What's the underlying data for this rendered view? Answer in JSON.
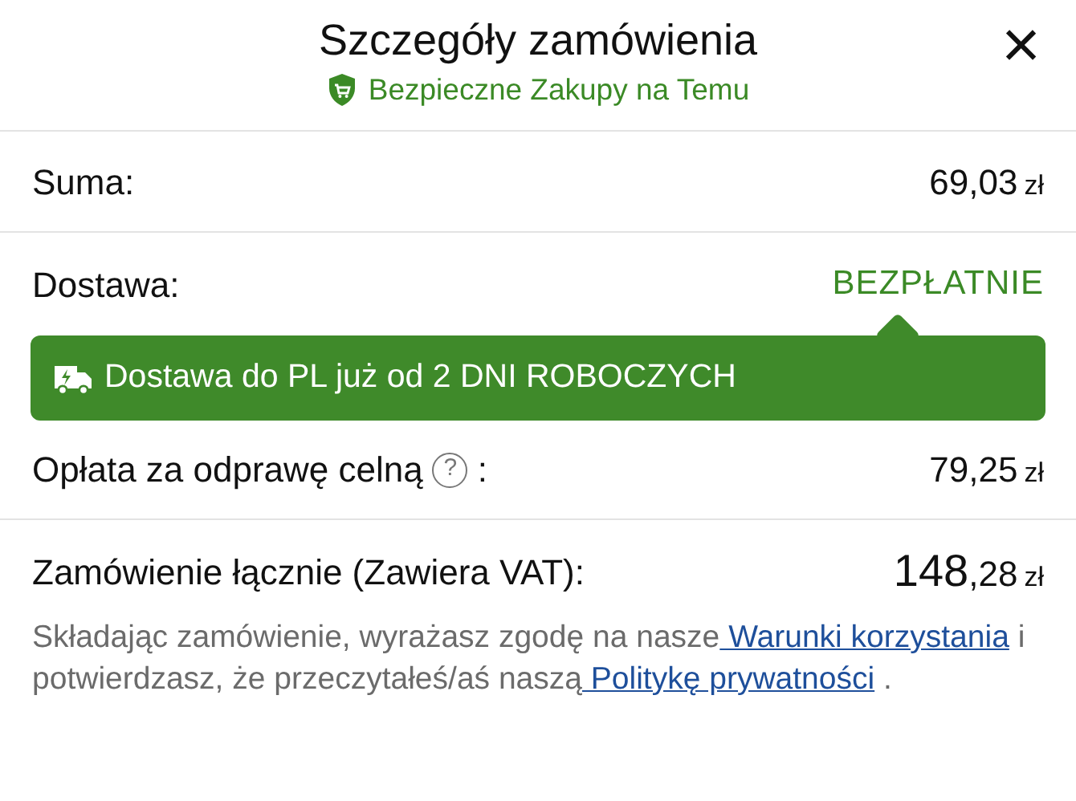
{
  "header": {
    "title": "Szczegóły zamówienia",
    "subtitle": "Bezpieczne Zakupy na Temu",
    "close": "×"
  },
  "rows": [
    {
      "kind": "amount",
      "label": "Suma:",
      "value": "69,03",
      "currency": "zł"
    },
    {
      "kind": "free",
      "label": "Dostawa:",
      "value": "BEZPŁATNIE",
      "banner": "Dostawa do PL już od 2 DNI ROBOCZYCH"
    },
    {
      "kind": "amount",
      "label": "Opłata za odprawę celną",
      "help": "?",
      "suffix": ":",
      "value": "79,25",
      "currency": "zł"
    }
  ],
  "total": {
    "label": "Zamówienie łącznie (Zawiera VAT):",
    "main": "148",
    "fraction": ",28",
    "currency": "zł"
  },
  "legal": [
    {
      "kind": "text",
      "text": "Składając zamówienie, wyrażasz zgodę na nasze"
    },
    {
      "kind": "link",
      "text": " Warunki korzystania"
    },
    {
      "kind": "text",
      "text": " i potwierdzasz, że przeczytałeś/aś naszą"
    },
    {
      "kind": "link",
      "text": " Politykę prywatności"
    },
    {
      "kind": "text",
      "text": " ."
    }
  ]
}
